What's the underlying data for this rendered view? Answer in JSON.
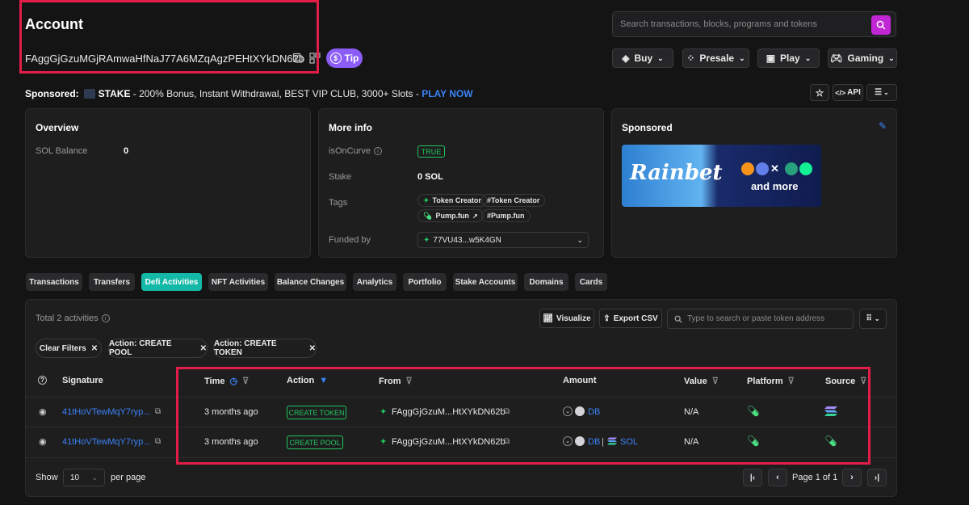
{
  "header": {
    "title": "Account",
    "address": "FAggGjGzuMGjRAmwaHfNaJ77A6MZqAgzPEHtXYkDN62b",
    "tip_label": "Tip",
    "search_placeholder": "Search transactions, blocks, programs and tokens"
  },
  "nav": {
    "buy": "Buy",
    "presale": "Presale",
    "play": "Play",
    "gaming": "Gaming"
  },
  "sponsor_line": {
    "prefix": "Sponsored:",
    "brand": "STAKE",
    "text": " - 200% Bonus, Instant Withdrawal, BEST VIP CLUB, 3000+ Slots - ",
    "cta": "PLAY NOW",
    "api_label": "API"
  },
  "overview": {
    "title": "Overview",
    "sol_label": "SOL Balance",
    "sol_value": "0"
  },
  "more_info": {
    "title": "More info",
    "curve_label": "isOnCurve",
    "curve_value": "TRUE",
    "stake_label": "Stake",
    "stake_value": "0 SOL",
    "tags_label": "Tags",
    "tags": [
      "Token Creator",
      "#Token Creator",
      "Pump.fun",
      "#Pump.fun"
    ],
    "funded_label": "Funded by",
    "funded_value": "77VU43...w5K4GN"
  },
  "sponsored": {
    "title": "Sponsored",
    "banner_brand": "Rainbet",
    "banner_text": "and more"
  },
  "tabs": [
    "Transactions",
    "Transfers",
    "Defi Activities",
    "NFT Activities",
    "Balance Changes",
    "Analytics",
    "Portfolio",
    "Stake Accounts",
    "Domains",
    "Cards"
  ],
  "activities": {
    "total": "Total 2 activities",
    "visualize": "Visualize",
    "export": "Export CSV",
    "search_placeholder": "Type to search or paste token address",
    "filters": [
      "Clear Filters",
      "Action: CREATE POOL",
      "Action: CREATE TOKEN"
    ],
    "columns": [
      "Signature",
      "Time",
      "Action",
      "From",
      "Amount",
      "Value",
      "Platform",
      "Source"
    ],
    "rows": [
      {
        "signature": "41tHoVTewMqY7ryp...",
        "time": "3 months ago",
        "action": "CREATE TOKEN",
        "from": "FAggGjGzuM...HtXYkDN62b",
        "amount_token": "DB",
        "amount_token2": "",
        "value": "N/A"
      },
      {
        "signature": "41tHoVTewMqY7ryp...",
        "time": "3 months ago",
        "action": "CREATE POOL",
        "from": "FAggGjGzuM...HtXYkDN62b",
        "amount_token": "DB",
        "amount_token2": "SOL",
        "value": "N/A"
      }
    ],
    "show_label": "Show",
    "per_page_value": "10",
    "per_page_label": "per page",
    "page_label": "Page 1 of 1"
  },
  "colors": {
    "accent": "#14b8a6",
    "link": "#3b82f6",
    "highlight": "#e11d48",
    "search_button": "#c026d3"
  }
}
